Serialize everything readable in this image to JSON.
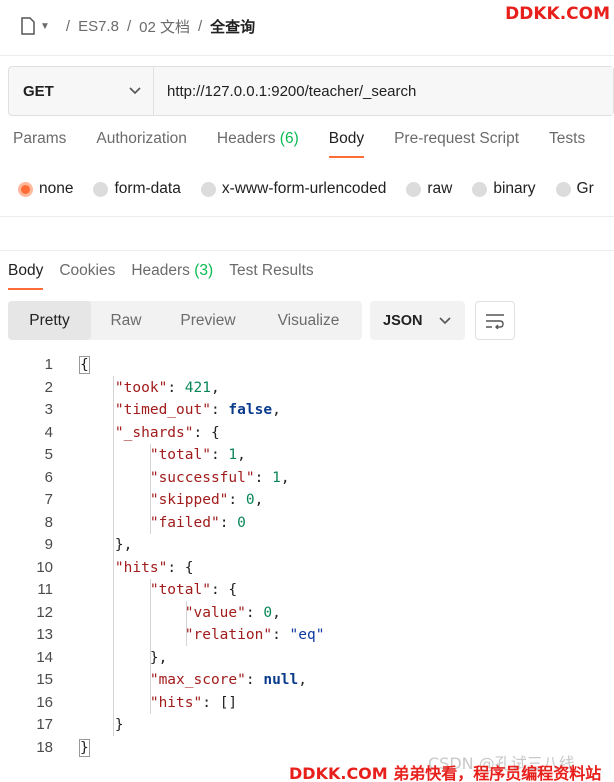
{
  "breadcrumb": {
    "items": [
      "ES7.8",
      "02 文档"
    ],
    "current": "全查询",
    "separator": "/"
  },
  "watermark_top": "DDKK.COM",
  "request": {
    "method": "GET",
    "url": "http://127.0.0.1:9200/teacher/_search"
  },
  "request_tabs": [
    {
      "label": "Params",
      "count": ""
    },
    {
      "label": "Authorization",
      "count": ""
    },
    {
      "label": "Headers",
      "count": "(6)"
    },
    {
      "label": "Body",
      "count": "",
      "active": true
    },
    {
      "label": "Pre-request Script",
      "count": ""
    },
    {
      "label": "Tests",
      "count": ""
    }
  ],
  "body_types": [
    "none",
    "form-data",
    "x-www-form-urlencoded",
    "raw",
    "binary",
    "Gr"
  ],
  "response_tabs": [
    {
      "label": "Body",
      "count": "",
      "active": true
    },
    {
      "label": "Cookies",
      "count": ""
    },
    {
      "label": "Headers",
      "count": "(3)"
    },
    {
      "label": "Test Results",
      "count": ""
    }
  ],
  "view_modes": [
    "Pretty",
    "Raw",
    "Preview",
    "Visualize"
  ],
  "format": "JSON",
  "code_lines": [
    "1",
    "2",
    "3",
    "4",
    "5",
    "6",
    "7",
    "8",
    "9",
    "10",
    "11",
    "12",
    "13",
    "14",
    "15",
    "16",
    "17",
    "18"
  ],
  "watermarks": {
    "csdn": "CSDN @孔试三八线",
    "bottom": "DDKK.COM 弟弟快看，程序员编程资料站"
  },
  "colors": {
    "accent": "#ff6c37",
    "count_green": "#0cbb52",
    "json_key": "#a11c1c",
    "json_number": "#098658",
    "json_keyword": "#0b3c8c",
    "watermark_red": "#e8201c"
  }
}
